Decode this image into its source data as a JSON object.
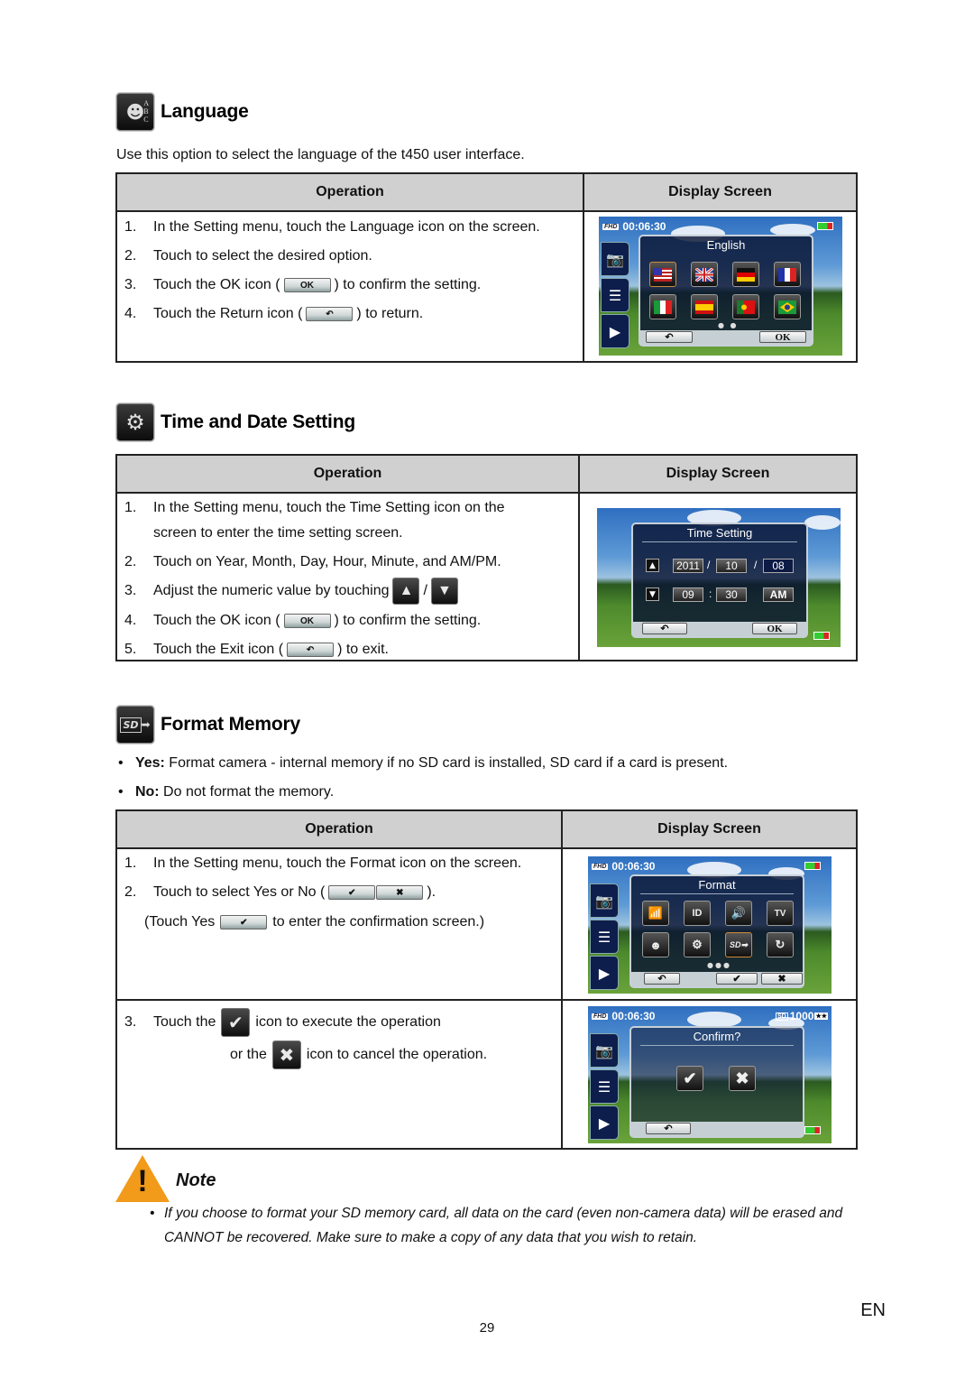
{
  "language": {
    "icon": "language-abc-icon",
    "title": "Language",
    "intro": "Use this option to select the language of the t450 user interface.",
    "table": {
      "headers": [
        "Operation",
        "Display Screen"
      ],
      "steps": [
        {
          "num": "1.",
          "text": "In the Setting menu, touch the Language  icon on the screen."
        },
        {
          "num": "2.",
          "text": "Touch to select the desired option."
        },
        {
          "num": "3.",
          "pre": "Touch the OK icon (",
          "button": "OK",
          "post": ") to confirm the setting."
        },
        {
          "num": "4.",
          "pre": "Touch the Return icon (",
          "button": "↶",
          "post": ") to return."
        }
      ]
    },
    "screen": {
      "time": "00:06:30",
      "badge": "FHD",
      "panel_title": "English",
      "flags": [
        "United States",
        "United Kingdom",
        "Germany",
        "France",
        "Italy",
        "Spain",
        "Portugal",
        "Brazil"
      ],
      "ok_label": "OK",
      "return_label": "↶"
    }
  },
  "time_date": {
    "icon": "gear-clock-icon",
    "title": "Time and Date Setting",
    "table": {
      "headers": [
        "Operation",
        "Display Screen"
      ],
      "steps": [
        {
          "num": "1.",
          "text": "In the Setting menu, touch the Time Setting  icon on the",
          "text2": "screen to enter the time setting screen."
        },
        {
          "num": "2.",
          "text": "Touch on Year, Month, Day, Hour, Minute, and AM/PM."
        },
        {
          "num": "3.",
          "pre": "Adjust the numeric value by touching",
          "sep": "/"
        },
        {
          "num": "4.",
          "pre": "Touch the OK icon (",
          "button": "OK",
          "post": ") to confirm the setting."
        },
        {
          "num": "5.",
          "pre": "Touch the Exit icon (",
          "button": "↶",
          "post": ") to exit."
        }
      ]
    },
    "screen": {
      "panel_title": "Time Setting",
      "year": "2011",
      "month": "10",
      "day": "08",
      "hour": "09",
      "minute": "30",
      "ampm": "AM",
      "date_sep": "/",
      "time_sep": ":",
      "ok_label": "OK",
      "return_label": "↶"
    }
  },
  "format": {
    "icon": "sd-card-format-icon",
    "title": "Format Memory",
    "bullets": [
      {
        "label": "Yes:",
        "text": " Format camera  - internal memory if no SD card is installed, SD card if a card is present."
      },
      {
        "label": "No:",
        "text": " Do not format the memory."
      }
    ],
    "table": {
      "headers": [
        "Operation",
        "Display Screen"
      ],
      "step1": {
        "num": "1.",
        "text": "In the Setting menu, touch the Format  icon on the screen."
      },
      "step2": {
        "num": "2.",
        "pre": "Touch to select Yes  or No  (",
        "post": ")."
      },
      "step2b": {
        "pre": "(Touch Yes",
        "post": "to enter the confirmation screen.)"
      },
      "step3": {
        "num": "3.",
        "pre": "Touch the",
        "post": "icon to execute the operation"
      },
      "step3b": {
        "pre": "or  the",
        "post": "icon to cancel the operation."
      }
    },
    "screen1": {
      "time": "00:06:30",
      "badge": "FHD",
      "panel_title": "Format",
      "tiles": [
        "wifi",
        "ID",
        "sound",
        "TV",
        "language",
        "time",
        "SD",
        "reset"
      ]
    },
    "screen2": {
      "time": "00:06:30",
      "badge": "FHD",
      "shots_remaining": "1000",
      "panel_title": "Confirm?"
    }
  },
  "note": {
    "title": "Note",
    "text": "If you choose to format your SD memory card, all data on the card (even non-camera data) will be erased and CANNOT be recovered. Make sure to make a copy of any data that you wish to retain."
  },
  "footer": {
    "lang": "EN",
    "page": "29"
  }
}
